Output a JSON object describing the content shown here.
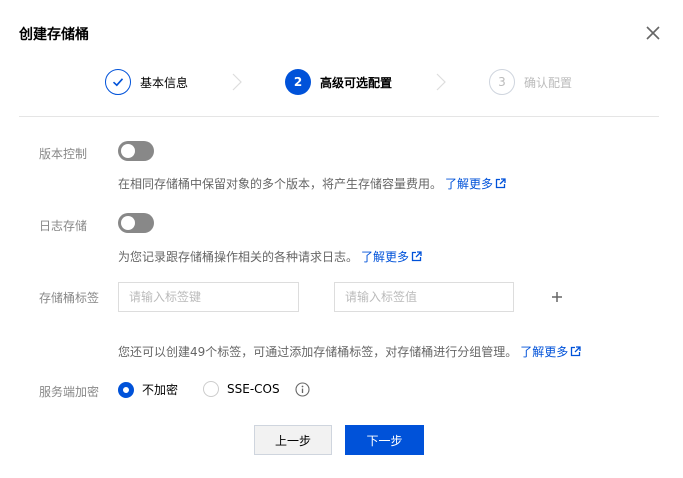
{
  "dialog": {
    "title": "创建存储桶"
  },
  "steps": [
    {
      "number": "1",
      "label": "基本信息",
      "state": "done"
    },
    {
      "number": "2",
      "label": "高级可选配置",
      "state": "active"
    },
    {
      "number": "3",
      "label": "确认配置",
      "state": "pending"
    }
  ],
  "versioning": {
    "label": "版本控制",
    "enabled": false,
    "description": "在相同存储桶中保留对象的多个版本，将产生存储容量费用。",
    "link": "了解更多"
  },
  "logging": {
    "label": "日志存储",
    "enabled": false,
    "description": "为您记录跟存储桶操作相关的各种请求日志。",
    "link": "了解更多"
  },
  "tags": {
    "label": "存储桶标签",
    "key_placeholder": "请输入标签键",
    "value_placeholder": "请输入标签值",
    "key_value": "",
    "value_value": "",
    "description": "您还可以创建49个标签，可通过添加存储桶标签，对存储桶进行分组管理。",
    "link": "了解更多"
  },
  "encryption": {
    "label": "服务端加密",
    "options": [
      "不加密",
      "SSE-COS"
    ],
    "selected": "不加密"
  },
  "footer": {
    "prev_label": "上一步",
    "next_label": "下一步"
  },
  "colors": {
    "primary": "#0052d9",
    "toggle_off": "#888888",
    "muted_text": "#888888",
    "disabled_text": "#bbbbbb"
  },
  "icons": {
    "close": "close-icon",
    "step_done": "check-icon",
    "step_arrow": "chevron-right-icon",
    "external_link": "external-link-icon",
    "add": "plus-icon",
    "info": "info-icon"
  }
}
